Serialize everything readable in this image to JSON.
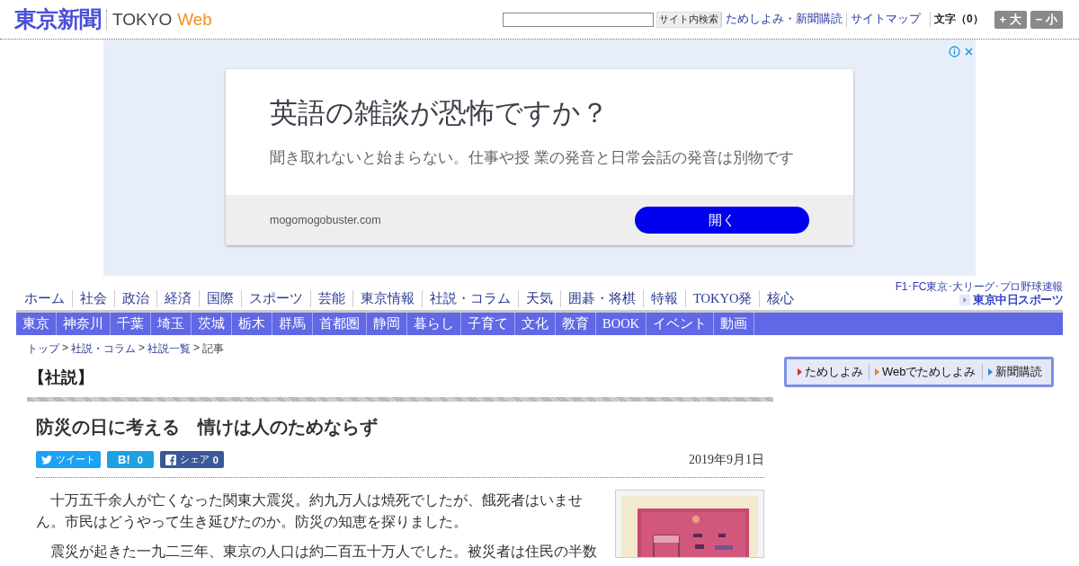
{
  "header": {
    "logo_name": "東京新聞",
    "logo_tokyo": "TOKYO",
    "logo_web": "Web",
    "search_button": "サイト内検索",
    "links": [
      "ためしよみ・新聞購読",
      "サイトマップ"
    ],
    "font_size_label": "文字（0）",
    "font_buttons": [
      "+ 大",
      "− 小"
    ]
  },
  "ad": {
    "title": "英語の雑談が恐怖ですか？",
    "description": "聞き取れないと始まらない。仕事や授 業の発音と日常会話の発音は別物です",
    "domain": "mogomogobuster.com",
    "button": "開く"
  },
  "nav_primary": [
    "ホーム",
    "社会",
    "政治",
    "経済",
    "国際",
    "スポーツ",
    "芸能",
    "東京情報",
    "社説・コラム",
    "天気",
    "囲碁・将棋",
    "特報",
    "TOKYO発",
    "核心"
  ],
  "nav_regional": [
    "東京",
    "神奈川",
    "千葉",
    "埼玉",
    "茨城",
    "栃木",
    "群馬",
    "首都圏",
    "静岡",
    "暮らし",
    "子育て",
    "文化",
    "教育",
    "BOOK",
    "イベント",
    "動画"
  ],
  "sports_promo": {
    "caption": "F1･FC東京･大リーグ･プロ野球速報",
    "brand": "東京中日スポーツ"
  },
  "breadcrumb": {
    "items": [
      "トップ",
      "社説・コラム",
      "社説一覧",
      "記事"
    ],
    "separator": ">"
  },
  "article": {
    "section": "【社説】",
    "title": "防災の日に考える　情けは人のためならず",
    "share_buttons": [
      {
        "kind": "twitter",
        "label": "ツイート"
      },
      {
        "kind": "hatena",
        "label": "B!",
        "count": "0"
      },
      {
        "kind": "facebook",
        "label": "シェア",
        "count": "0"
      }
    ],
    "date": "2019年9月1日",
    "paragraphs": [
      "十万五千余人が亡くなった関東大震災。約九万人は焼死でしたが、餓死者はいません。市民はどうやって生き延びたのか。防災の知恵を探りました。",
      "震災が起きた一九二三年、東京の人口は約二百五十万人でした。被災者は住民の半数"
    ],
    "photo": {
      "kind": "picture"
    }
  },
  "subscribe_box": [
    {
      "label": "ためしよみ",
      "color": "#e02a1a"
    },
    {
      "label": "Webでためしよみ",
      "color": "#f08020"
    },
    {
      "label": "新聞購読",
      "color": "#2a8ae8"
    }
  ]
}
